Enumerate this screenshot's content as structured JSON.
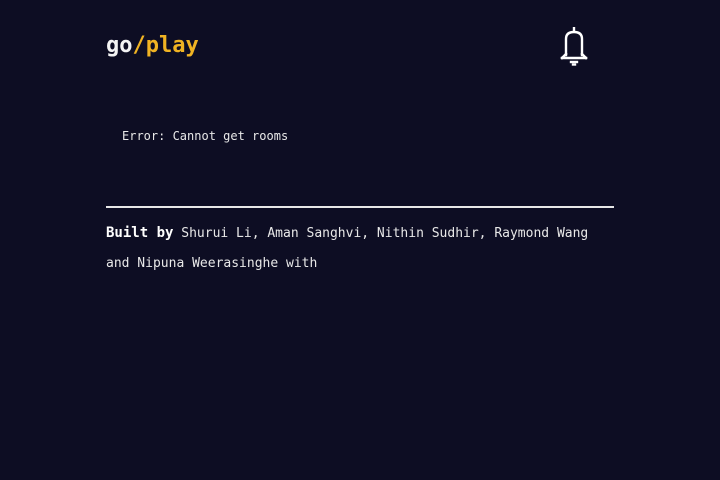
{
  "header": {
    "logo_go": "go",
    "logo_slash": "/",
    "logo_play": "play",
    "notification_icon": "bell-icon"
  },
  "main": {
    "error_message": "Error: Cannot get rooms"
  },
  "footer": {
    "built_by_label": "Built by",
    "credits_text": "Shurui Li, Aman Sanghvi, Nithin Sudhir, Raymond Wang and Nipuna Weerasinghe with"
  },
  "colors": {
    "background": "#0d0d23",
    "accent": "#f0b323",
    "text": "#f2f2f2"
  }
}
